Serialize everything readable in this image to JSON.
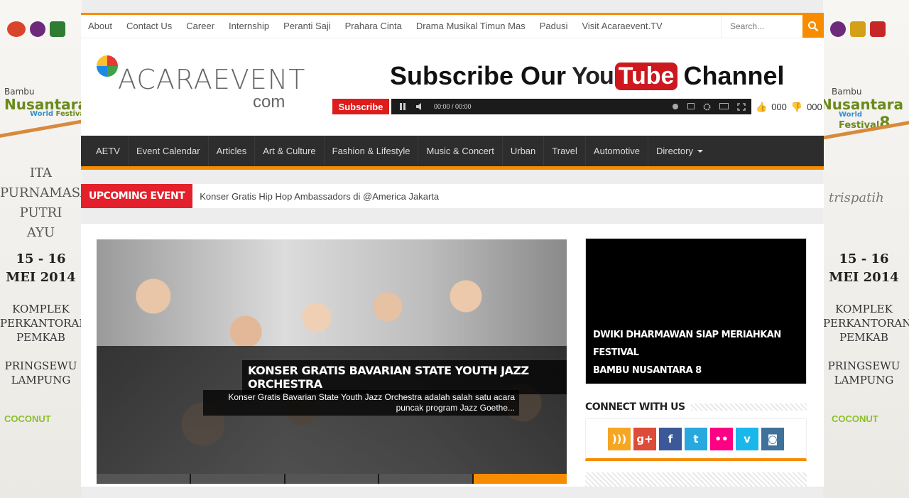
{
  "side_left": {
    "brand_top": "Bambu",
    "brand_main": "Nusantara",
    "brand_sub1": "World",
    "brand_sub2": "Festival",
    "name_lines": [
      "ITA",
      "PURNAMASARI",
      "PUTRI",
      "AYU"
    ],
    "date_lines": [
      "15 - 16",
      "MEI 2014"
    ],
    "loc_lines": [
      "KOMPLEK",
      "PERKANTORAN",
      "PEMKAB"
    ],
    "city_lines": [
      "PRINGSEWU",
      "LAMPUNG"
    ],
    "sponsor": "COCONUT"
  },
  "side_right": {
    "brand_top": "Bambu",
    "brand_main": "Nusantara",
    "brand_sub1": "World",
    "brand_sub2": "Festival",
    "brand_num": "8",
    "name_word": "trispatih",
    "date_lines": [
      "15 - 16",
      "MEI 2014"
    ],
    "loc_lines": [
      "KOMPLEK",
      "PERKANTORAN",
      "PEMKAB"
    ],
    "city_lines": [
      "PRINGSEWU",
      "LAMPUNG"
    ],
    "sponsor": "COCONUT"
  },
  "topnav": {
    "links": [
      "About",
      "Contact Us",
      "Career",
      "Internship",
      "Peranti Saji",
      "Prahara Cinta",
      "Drama Musikal Timun Mas",
      "Padusi",
      "Visit Acaraevent.TV"
    ],
    "search_placeholder": "Search..."
  },
  "header": {
    "logo_name": "ACARAEVENT",
    "logo_sub": "com",
    "yt_prefix": "Subscribe Our",
    "yt_you": "You",
    "yt_tube": "Tube",
    "yt_suffix": "Channel",
    "subscribe_label": "Subscribe",
    "player_time": "00:00 / 00:00",
    "likes": "000",
    "dislikes": "000"
  },
  "mainnav": {
    "items": [
      "AETV",
      "Event Calendar",
      "Articles",
      "Art & Culture",
      "Fashion & Lifestyle",
      "Music & Concert",
      "Urban",
      "Travel",
      "Automotive",
      "Directory"
    ]
  },
  "ticker": {
    "label": "UPCOMING EVENT",
    "text": "Konser Gratis Hip Hop Ambassadors di @America Jakarta"
  },
  "slider": {
    "title": "KONSER GRATIS BAVARIAN STATE YOUTH JAZZ ORCHESTRA",
    "excerpt_line1": "Konser Gratis Bavarian State Youth Jazz Orchestra adalah salah satu acara",
    "excerpt_line2": "puncak program Jazz Goethe...",
    "active_index": 4
  },
  "video": {
    "caption_line1": "DWIKI DHARMAWAN SIAP MERIAHKAN FESTIVAL",
    "caption_line2": "BAMBU NUSANTARA 8"
  },
  "connect": {
    "title": "CONNECT WITH US",
    "icons": [
      {
        "name": "rss-icon",
        "glyph": ")))",
        "color": "#f5a623"
      },
      {
        "name": "google-plus-icon",
        "glyph": "g+",
        "color": "#dd4b39"
      },
      {
        "name": "facebook-icon",
        "glyph": "f",
        "color": "#3b5998"
      },
      {
        "name": "twitter-icon",
        "glyph": "t",
        "color": "#29a8e0"
      },
      {
        "name": "flickr-icon",
        "glyph": "••",
        "color": "#ff0084"
      },
      {
        "name": "vimeo-icon",
        "glyph": "v",
        "color": "#1ab7ea"
      },
      {
        "name": "instagram-icon",
        "glyph": "◙",
        "color": "#3f729b"
      }
    ]
  },
  "colors": {
    "accent": "#f88c00",
    "ticker_red": "#e3202b",
    "nav_bg": "#2d2d2d"
  }
}
